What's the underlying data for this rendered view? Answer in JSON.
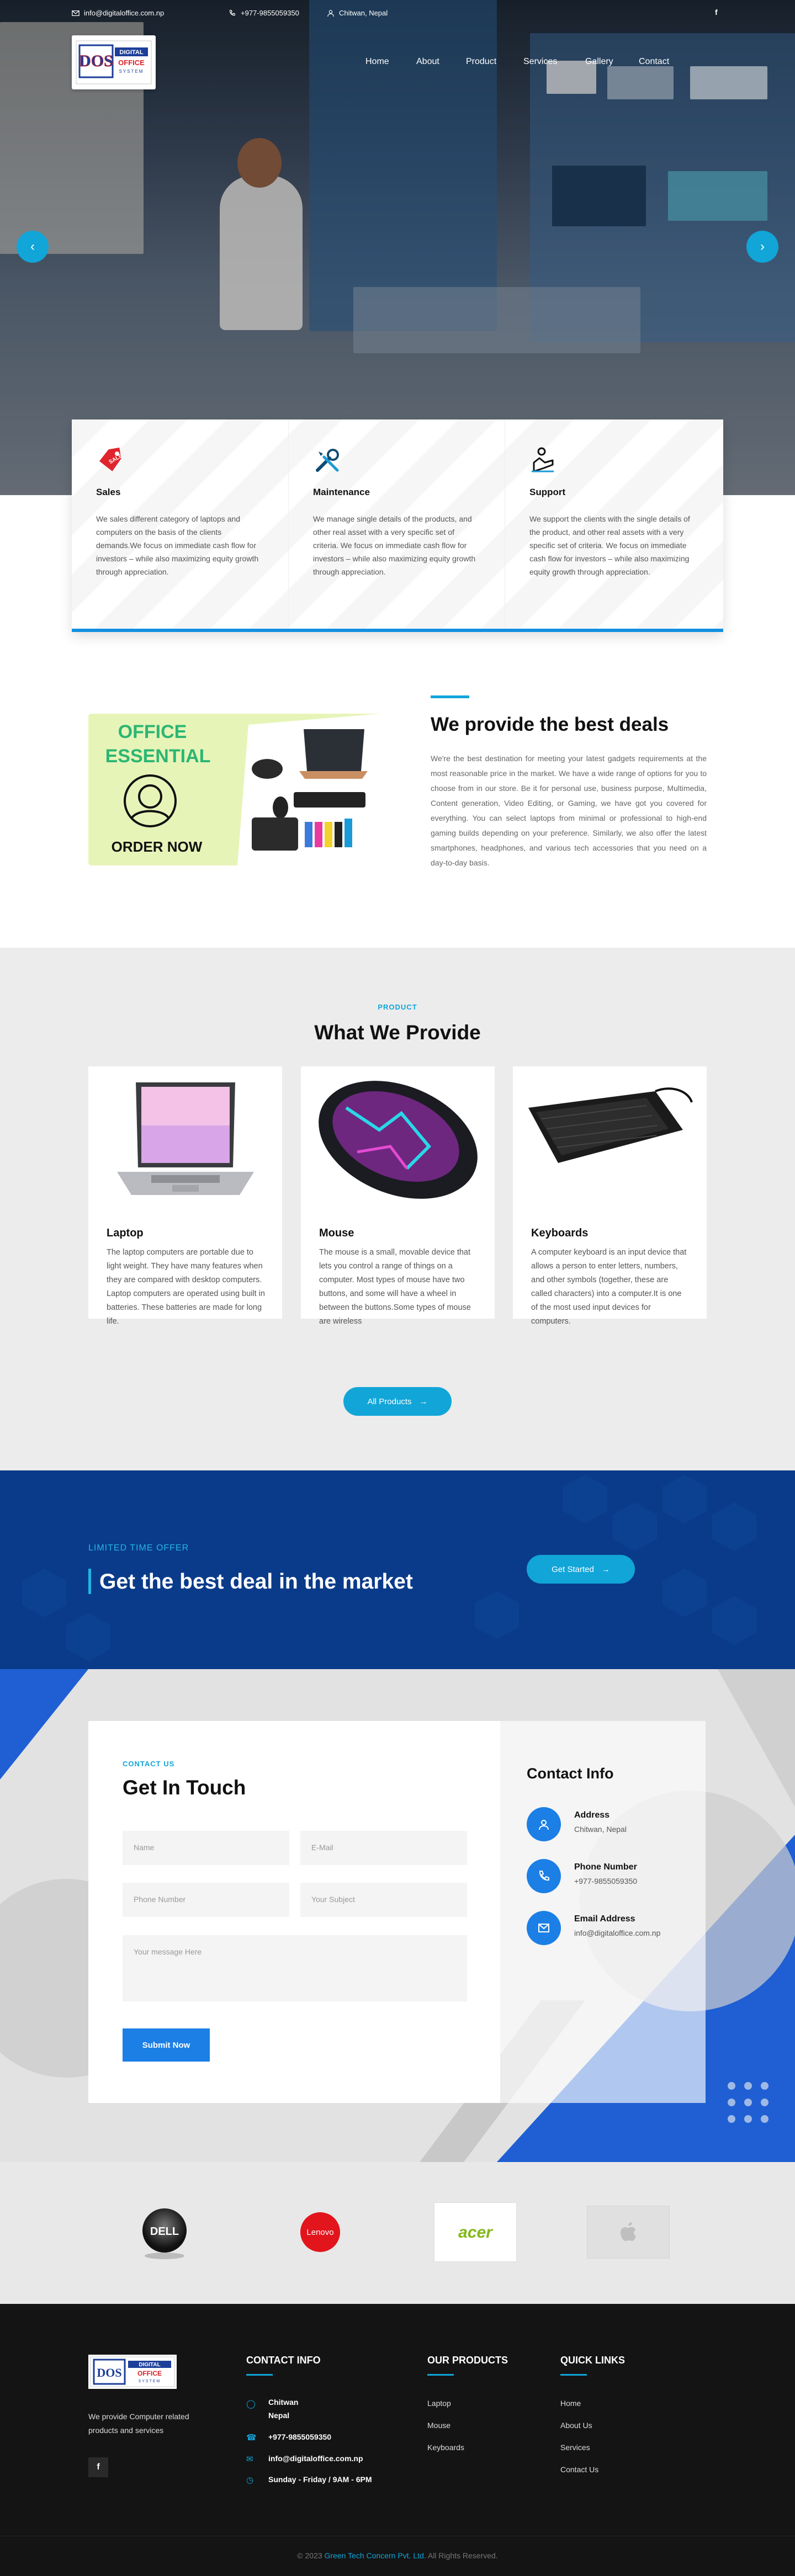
{
  "topbar": {
    "email": "info@digitaloffice.com.np",
    "phone": "+977-9855059350",
    "location": "Chitwan, Nepal",
    "social": "f"
  },
  "logo": {
    "mark": "DOS",
    "line1": "DIGITAL",
    "line2": "OFFICE",
    "line3": "SYSTEM"
  },
  "nav": {
    "items": [
      "Home",
      "About",
      "Product",
      "Services",
      "Gallery",
      "Contact"
    ]
  },
  "services": [
    {
      "icon": "sale-tag-icon",
      "title": "Sales",
      "text": "We sales different category of laptops and computers on the basis of the clients demands.We focus on immediate cash flow for investors – while also maximizing equity growth through appreciation."
    },
    {
      "icon": "tools-icon",
      "title": "Maintenance",
      "text": "We manage single details of the products, and other real asset with a very specific set of criteria. We focus on immediate cash flow for investors – while also maximizing equity growth through appreciation."
    },
    {
      "icon": "support-hand-icon",
      "title": "Support",
      "text": "We support the clients with the single details of the product, and other real assets with a very specific set of criteria. We focus on immediate cash flow for investors – while also maximizing equity growth through appreciation."
    }
  ],
  "deals": {
    "promo_line1": "OFFICE",
    "promo_line2": "ESSENTIAL",
    "promo_cta": "ORDER NOW",
    "heading": "We provide the best deals",
    "text": "We're the best destination for meeting your latest gadgets requirements at the most reasonable price in the market. We have a wide range of options for you to choose from in our store. Be it for personal use, business purpose, Multimedia, Content generation, Video Editing, or Gaming, we have got you covered for everything. You can select laptops from minimal or professional to high-end gaming builds depending on your preference. Similarly, we also offer the latest smartphones, headphones, and various tech accessories that you need on a day-to-day basis."
  },
  "products": {
    "kicker": "PRODUCT",
    "heading": "What We Provide",
    "items": [
      {
        "title": "Laptop",
        "text": "The laptop computers are portable due to light weight. They have many features when they are compared with desktop computers. Laptop computers are operated using built in batteries. These batteries are made for long life."
      },
      {
        "title": "Mouse",
        "text": "The mouse is a small, movable device that lets you control a range of things on a computer. Most types of mouse have two buttons, and some will have a wheel in between the buttons.Some types of mouse are wireless"
      },
      {
        "title": "Keyboards",
        "text": "A computer keyboard is an input device that allows a person to enter letters, numbers, and other symbols (together, these are called characters) into a computer.It is one of the most used input devices for computers."
      }
    ],
    "button": "All Products"
  },
  "offer": {
    "kicker": "LIMITED TIME OFFER",
    "heading": "Get the best deal in the market",
    "button": "Get Started"
  },
  "contact": {
    "kicker": "CONTACT US",
    "heading": "Get In Touch",
    "placeholders": {
      "name": "Name",
      "email": "E-Mail",
      "phone": "Phone Number",
      "subject": "Your Subject",
      "message": "Your message Here"
    },
    "submit": "Submit Now",
    "info_heading": "Contact Info",
    "info": [
      {
        "icon": "location-icon",
        "title": "Address",
        "value": "Chitwan, Nepal"
      },
      {
        "icon": "phone-icon",
        "title": "Phone Number",
        "value": "+977-9855059350"
      },
      {
        "icon": "email-icon",
        "title": "Email Address",
        "value": "info@digitaloffice.com.np"
      }
    ]
  },
  "brands": [
    "DELL",
    "Lenovo",
    "acer",
    "apple"
  ],
  "footer": {
    "about": "We provide Computer related products and services",
    "social": "f",
    "contact_heading": "CONTACT INFO",
    "contact": {
      "address_line1": "Chitwan",
      "address_line2": "Nepal",
      "phone": "+977-9855059350",
      "email": "info@digitaloffice.com.np",
      "hours": "Sunday - Friday / 9AM - 6PM"
    },
    "products_heading": "OUR PRODUCTS",
    "products": [
      "Laptop",
      "Mouse",
      "Keyboards"
    ],
    "links_heading": "QUICK LINKS",
    "links": [
      "Home",
      "About Us",
      "Services",
      "Contact Us"
    ],
    "copyright_prefix": "© 2023",
    "copyright_company": "Green Tech Concern Pvt. Ltd.",
    "copyright_suffix": "All Rights Reserved."
  },
  "colors": {
    "accent": "#11a5d8",
    "primary_blue": "#1b7fe6",
    "banner_blue": "#0a3b8a",
    "footer_bg": "#141414"
  }
}
